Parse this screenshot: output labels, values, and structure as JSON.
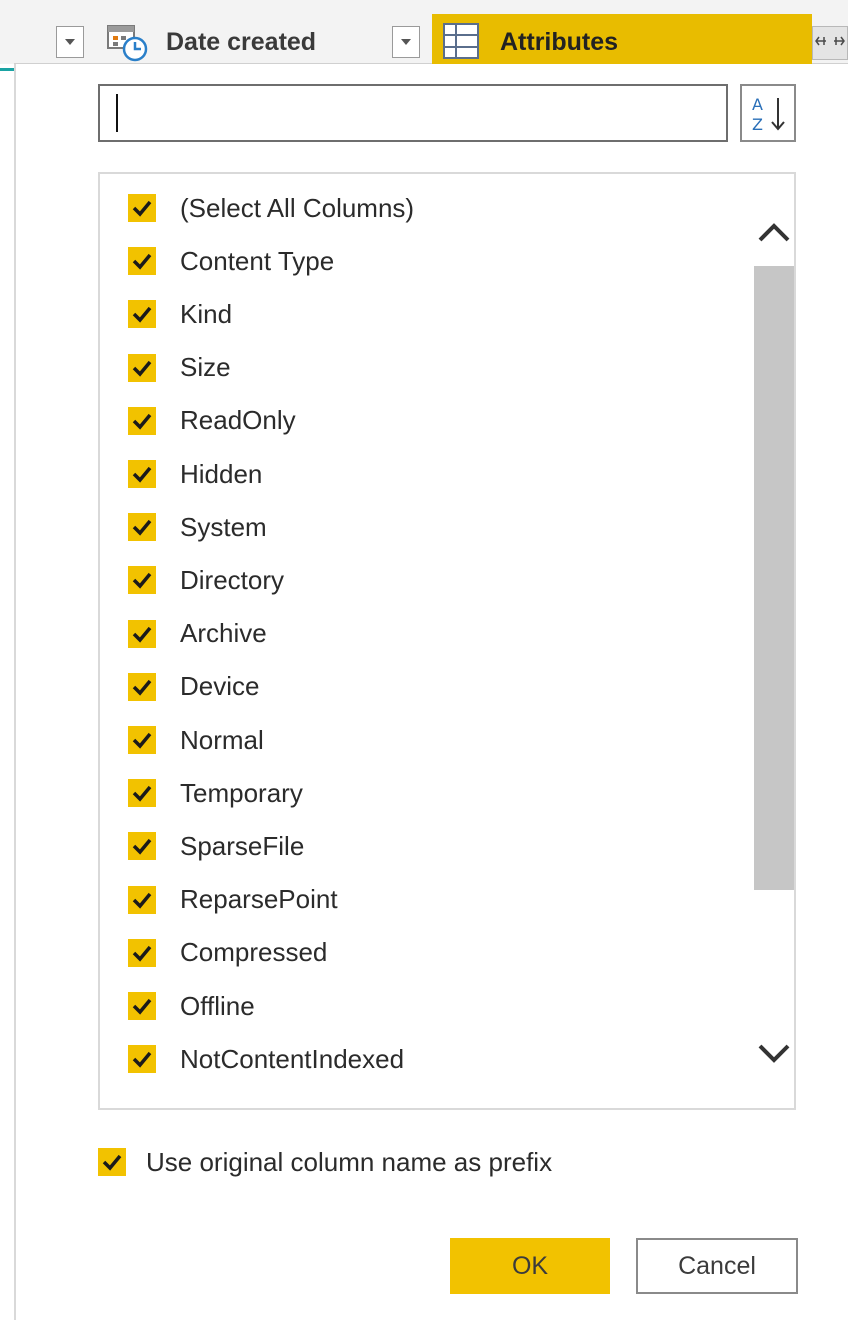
{
  "header": {
    "columns": [
      {
        "label": "Date created",
        "icon": "datetime-icon"
      },
      {
        "label": "Attributes",
        "icon": "table-icon",
        "accent": "#e8bc00"
      }
    ],
    "expand_icon": "expand-columns-icon"
  },
  "dialog": {
    "search": {
      "value": "",
      "placeholder": ""
    },
    "sort_icon": "sort-az-icon",
    "items": [
      {
        "label": "(Select All Columns)",
        "checked": true
      },
      {
        "label": "Content Type",
        "checked": true
      },
      {
        "label": "Kind",
        "checked": true
      },
      {
        "label": "Size",
        "checked": true
      },
      {
        "label": "ReadOnly",
        "checked": true
      },
      {
        "label": "Hidden",
        "checked": true
      },
      {
        "label": "System",
        "checked": true
      },
      {
        "label": "Directory",
        "checked": true
      },
      {
        "label": "Archive",
        "checked": true
      },
      {
        "label": "Device",
        "checked": true
      },
      {
        "label": "Normal",
        "checked": true
      },
      {
        "label": "Temporary",
        "checked": true
      },
      {
        "label": "SparseFile",
        "checked": true
      },
      {
        "label": "ReparsePoint",
        "checked": true
      },
      {
        "label": "Compressed",
        "checked": true
      },
      {
        "label": "Offline",
        "checked": true
      },
      {
        "label": "NotContentIndexed",
        "checked": true
      }
    ],
    "prefix_option": {
      "label": "Use original column name as prefix",
      "checked": true
    },
    "ok_label": "OK",
    "cancel_label": "Cancel"
  },
  "colors": {
    "accent": "#f2c200",
    "header_accent": "#e8bc00"
  }
}
